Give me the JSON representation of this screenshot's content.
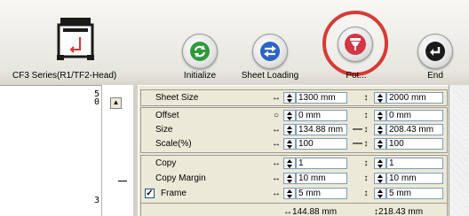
{
  "toolbar": {
    "device_label": "CF3 Series(R1/TF2-Head)",
    "buttons": [
      {
        "label": "Initialize",
        "icon": "refresh-icon",
        "color": "#2e9b3a"
      },
      {
        "label": "Sheet Loading",
        "icon": "swap-arrows-icon",
        "color": "#2a64c8"
      },
      {
        "label": "Pot...",
        "icon": "plotter-pen-icon",
        "color": "#d23843"
      },
      {
        "label": "End",
        "icon": "return-arrow-icon",
        "color": "#1a1a1a"
      }
    ],
    "highlight_color": "#d73a35"
  },
  "ruler": {
    "top_number": "5\n0",
    "bottom_number": "3"
  },
  "panel": {
    "sheet_size": {
      "label": "Sheet Size",
      "width": "1300 mm",
      "height": "2000 mm",
      "width_symbol": "↔",
      "height_symbol": "↕"
    },
    "offset": {
      "label": "Offset",
      "width": "0 mm",
      "height": "0 mm",
      "width_symbol": "○",
      "height_symbol": "↕"
    },
    "size": {
      "label": "Size",
      "width": "134.88 mm",
      "height": "208.43 mm",
      "width_symbol": "↔",
      "height_symbol": "↕",
      "link": "—"
    },
    "scale": {
      "label": "Scale(%)",
      "width": "100",
      "height": "100",
      "width_symbol": "↔",
      "height_symbol": "↕",
      "link": "—"
    },
    "copy": {
      "label": "Copy",
      "width": "1",
      "height": "1",
      "width_symbol": "↔",
      "height_symbol": "↕"
    },
    "copy_margin": {
      "label": "Copy Margin",
      "width": "10 mm",
      "height": "10 mm",
      "width_symbol": "↔",
      "height_symbol": "↕"
    },
    "frame": {
      "label": "Frame",
      "checked": "✓",
      "width": "5 mm",
      "height": "5 mm",
      "width_symbol": "↔",
      "height_symbol": "↕"
    },
    "total": {
      "width": "↔144.88 mm",
      "height": "↕218.43 mm"
    }
  }
}
